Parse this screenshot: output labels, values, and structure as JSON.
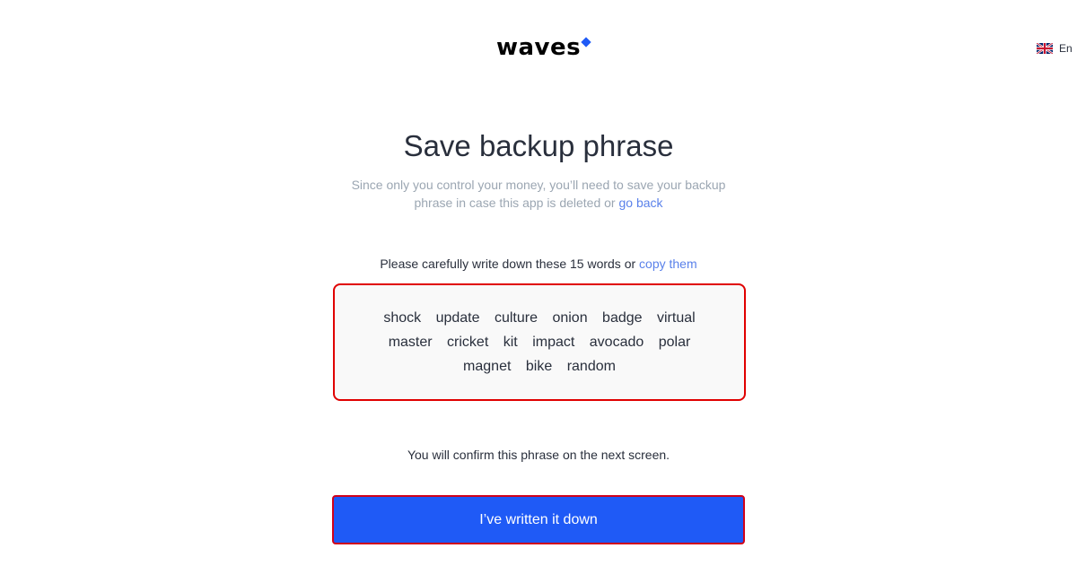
{
  "header": {
    "logo_text": "waves",
    "language": "En"
  },
  "main": {
    "title": "Save backup phrase",
    "subtitle_text": "Since only you control your money, you’ll need to save your backup phrase in case this app is deleted or ",
    "go_back_link": "go back",
    "instruction_text": "Please carefully write down these 15 words or ",
    "copy_link": "copy them",
    "phrase_words": [
      "shock",
      "update",
      "culture",
      "onion",
      "badge",
      "virtual",
      "master",
      "cricket",
      "kit",
      "impact",
      "avocado",
      "polar",
      "magnet",
      "bike",
      "random"
    ],
    "confirm_note": "You will confirm this phrase on the next screen.",
    "button_label": "I’ve written it down"
  },
  "colors": {
    "accent": "#1f5af6",
    "link": "#5a81ea",
    "highlight_border": "#e00000",
    "muted_text": "#9ba6b2"
  },
  "icons": {
    "logo_mark": "blue-diamond-icon",
    "language_flag": "uk-flag-icon"
  }
}
